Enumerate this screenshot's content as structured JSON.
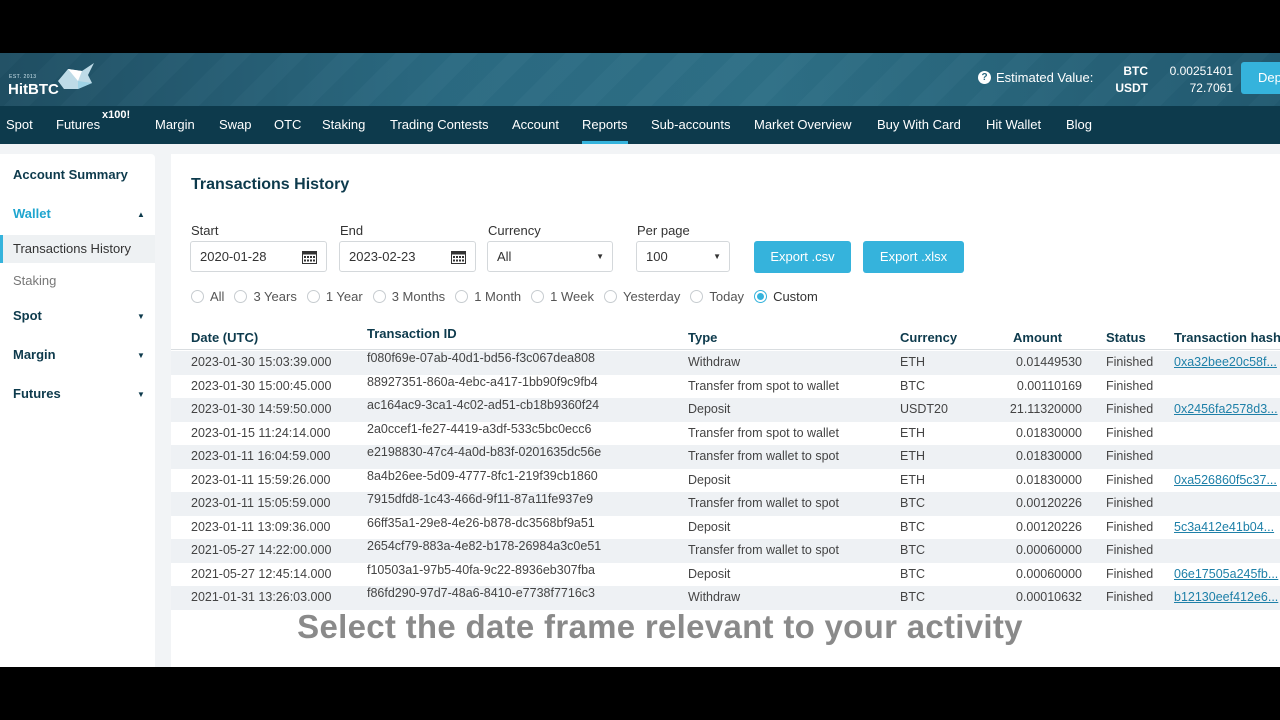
{
  "header": {
    "logo_est": "EST. 2013",
    "logo_name": "HitBTC",
    "estimated_label": "Estimated Value:",
    "balances": [
      {
        "currency": "BTC",
        "value": "0.00251401"
      },
      {
        "currency": "USDT",
        "value": "72.7061"
      }
    ],
    "deposit_label": "Dep"
  },
  "nav": {
    "items": [
      "Spot",
      "Futures",
      "Margin",
      "Swap",
      "OTC",
      "Staking",
      "Trading Contests",
      "Account",
      "Reports",
      "Sub-accounts",
      "Market Overview",
      "Buy With Card",
      "Hit Wallet",
      "Blog"
    ],
    "futures_badge": "x100!",
    "active": "Reports"
  },
  "sidebar": {
    "account_summary": "Account Summary",
    "wallet": "Wallet",
    "transactions_history": "Transactions History",
    "staking": "Staking",
    "spot": "Spot",
    "margin": "Margin",
    "futures": "Futures"
  },
  "main": {
    "title": "Transactions History",
    "filters": {
      "start_label": "Start",
      "start_value": "2020-01-28",
      "end_label": "End",
      "end_value": "2023-02-23",
      "currency_label": "Currency",
      "currency_value": "All",
      "perpage_label": "Per page",
      "perpage_value": "100",
      "export_csv": "Export .csv",
      "export_xlsx": "Export .xlsx"
    },
    "ranges": [
      "All",
      "3 Years",
      "1 Year",
      "3 Months",
      "1 Month",
      "1 Week",
      "Yesterday",
      "Today",
      "Custom"
    ],
    "range_selected": "Custom",
    "columns": [
      "Date (UTC)",
      "Transaction ID",
      "Type",
      "Currency",
      "Amount",
      "Status",
      "Transaction hash"
    ],
    "rows": [
      [
        "2023-01-30 15:03:39.000",
        "f080f69e-07ab-40d1-bd56-f3c067dea808",
        "Withdraw",
        "ETH",
        "0.01449530",
        "Finished",
        "0xa32bee20c58f..."
      ],
      [
        "2023-01-30 15:00:45.000",
        "88927351-860a-4ebc-a417-1bb90f9c9fb4",
        "Transfer from spot to wallet",
        "BTC",
        "0.00110169",
        "Finished",
        ""
      ],
      [
        "2023-01-30 14:59:50.000",
        "ac164ac9-3ca1-4c02-ad51-cb18b9360f24",
        "Deposit",
        "USDT20",
        "21.11320000",
        "Finished",
        "0x2456fa2578d3..."
      ],
      [
        "2023-01-15 11:24:14.000",
        "2a0ccef1-fe27-4419-a3df-533c5bc0ecc6",
        "Transfer from spot to wallet",
        "ETH",
        "0.01830000",
        "Finished",
        ""
      ],
      [
        "2023-01-11 16:04:59.000",
        "e2198830-47c4-4a0d-b83f-0201635dc56e",
        "Transfer from wallet to spot",
        "ETH",
        "0.01830000",
        "Finished",
        ""
      ],
      [
        "2023-01-11 15:59:26.000",
        "8a4b26ee-5d09-4777-8fc1-219f39cb1860",
        "Deposit",
        "ETH",
        "0.01830000",
        "Finished",
        "0xa526860f5c37..."
      ],
      [
        "2023-01-11 15:05:59.000",
        "7915dfd8-1c43-466d-9f11-87a11fe937e9",
        "Transfer from wallet to spot",
        "BTC",
        "0.00120226",
        "Finished",
        ""
      ],
      [
        "2023-01-11 13:09:36.000",
        "66ff35a1-29e8-4e26-b878-dc3568bf9a51",
        "Deposit",
        "BTC",
        "0.00120226",
        "Finished",
        "5c3a412e41b04..."
      ],
      [
        "2021-05-27 14:22:00.000",
        "2654cf79-883a-4e82-b178-26984a3c0e51",
        "Transfer from wallet to spot",
        "BTC",
        "0.00060000",
        "Finished",
        ""
      ],
      [
        "2021-05-27 12:45:14.000",
        "f10503a1-97b5-40fa-9c22-8936eb307fba",
        "Deposit",
        "BTC",
        "0.00060000",
        "Finished",
        "06e17505a245fb..."
      ],
      [
        "2021-01-31 13:26:03.000",
        "f86fd290-97d7-48a6-8410-e7738f7716c3",
        "Withdraw",
        "BTC",
        "0.00010632",
        "Finished",
        "b12130eef412e6..."
      ]
    ]
  },
  "caption": "Select the date frame relevant to your activity",
  "colors": {
    "accent": "#35b3dc",
    "nav_bg": "#0d3a4c",
    "title": "#0d3a4c"
  }
}
